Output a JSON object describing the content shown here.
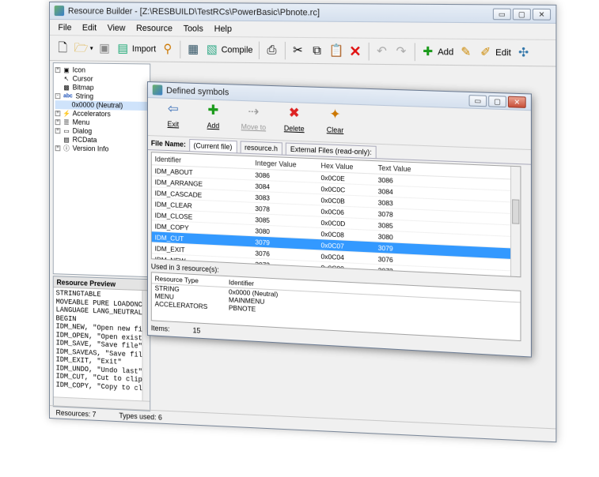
{
  "main_window": {
    "title": "Resource Builder - [Z:\\RESBUILD\\TestRCs\\PowerBasic\\Pbnote.rc]",
    "window_buttons": [
      "▭",
      "▢",
      "✕"
    ],
    "menu": [
      "File",
      "Edit",
      "View",
      "Resource",
      "Tools",
      "Help"
    ],
    "toolbar": {
      "import": "Import",
      "compile": "Compile",
      "add": "Add",
      "edit": "Edit"
    }
  },
  "tree": [
    {
      "label": "Icon",
      "expander": "+",
      "icon": "icon-resource-icon"
    },
    {
      "label": "Cursor",
      "expander": "",
      "icon": "cursor-icon"
    },
    {
      "label": "Bitmap",
      "expander": "",
      "icon": "bitmap-icon"
    },
    {
      "label": "String",
      "expander": "-",
      "icon": "string-icon",
      "prefix": "abc"
    },
    {
      "label": "0x0000 (Neutral)",
      "expander": "",
      "icon": "",
      "selected": true
    },
    {
      "label": "Accelerators",
      "expander": "+",
      "icon": "accelerator-icon"
    },
    {
      "label": "Menu",
      "expander": "+",
      "icon": "menu-icon"
    },
    {
      "label": "Dialog",
      "expander": "+",
      "icon": "dialog-icon"
    },
    {
      "label": "RCData",
      "expander": "",
      "icon": "rcdata-icon"
    },
    {
      "label": "Version Info",
      "expander": "+",
      "icon": "version-icon"
    }
  ],
  "preview": {
    "title": "Resource Preview",
    "lines": [
      "STRINGTABLE",
      "MOVEABLE PURE LOADONC",
      "LANGUAGE LANG_NEUTRAL",
      "BEGIN",
      "IDM_NEW, \"Open new fi",
      "IDM_OPEN, \"Open exist",
      "IDM_SAVE, \"Save file\"",
      "IDM_SAVEAS, \"Save fil",
      "IDM_EXIT, \"Exit\"",
      "IDM_UNDO, \"Undo last\"",
      "IDM_CUT, \"Cut to clip",
      "IDM_COPY, \"Copy to cl"
    ]
  },
  "status": {
    "resources": "Resources: 7",
    "types": "Types used: 6"
  },
  "dialog": {
    "title": "Defined symbols",
    "buttons": [
      {
        "label": "Exit",
        "icon": "exit-icon",
        "enabled": true
      },
      {
        "label": "Add",
        "icon": "add-icon",
        "enabled": true
      },
      {
        "label": "Move to",
        "icon": "move-to-icon",
        "enabled": false
      },
      {
        "label": "Delete",
        "icon": "delete-icon",
        "enabled": true
      },
      {
        "label": "Clear",
        "icon": "clear-icon",
        "enabled": true
      }
    ],
    "file_name_label": "File Name:",
    "tabs": [
      "(Current file)",
      "resource.h",
      "External Files (read-only):"
    ],
    "columns": [
      "Identifier",
      "Integer Value",
      "Hex Value",
      "Text Value"
    ],
    "rows": [
      [
        "IDM_ABOUT",
        "3086",
        "0x0C0E",
        "3086"
      ],
      [
        "IDM_ARRANGE",
        "3084",
        "0x0C0C",
        "3084"
      ],
      [
        "IDM_CASCADE",
        "3083",
        "0x0C0B",
        "3083"
      ],
      [
        "IDM_CLEAR",
        "3078",
        "0x0C06",
        "3078"
      ],
      [
        "IDM_CLOSE",
        "3085",
        "0x0C0D",
        "3085"
      ],
      [
        "IDM_COPY",
        "3080",
        "0x0C08",
        "3080"
      ],
      [
        "IDM_CUT",
        "3079",
        "0x0C07",
        "3079"
      ],
      [
        "IDM_EXIT",
        "3076",
        "0x0C04",
        "3076"
      ],
      [
        "IDM_NEW",
        "3072",
        "0x0C00",
        "3072"
      ]
    ],
    "selected_row": 6,
    "used_in": "Used in 3 resource(s):",
    "res_columns": [
      "Resource Type",
      "Identifier"
    ],
    "res_rows": [
      [
        "STRING",
        "0x0000 (Neutral)"
      ],
      [
        "MENU",
        "MAINMENU"
      ],
      [
        "ACCELERATORS",
        "PBNOTE"
      ]
    ],
    "items_label": "Items:",
    "items_count": "15",
    "selection_color": "#3399ff"
  }
}
